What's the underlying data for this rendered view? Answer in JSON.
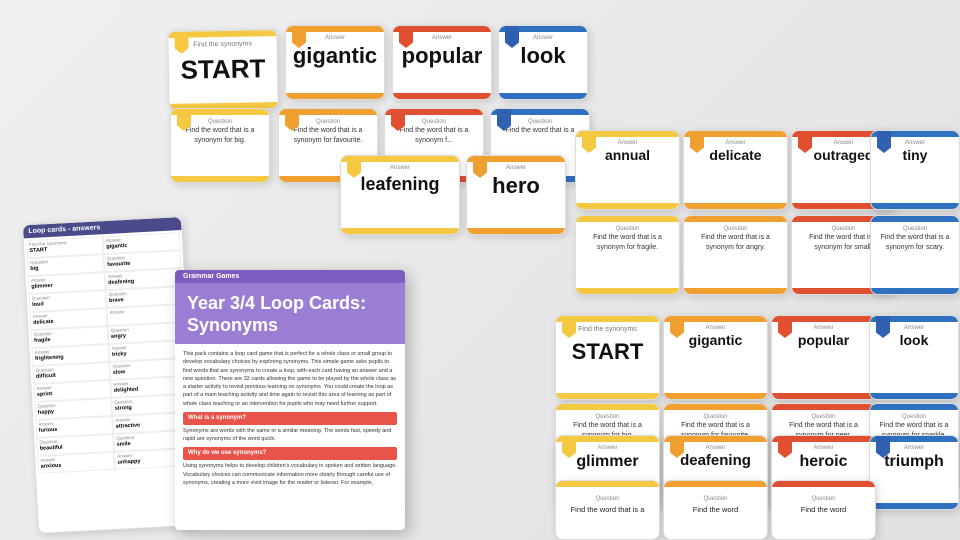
{
  "scene": {
    "bg_color": "#e8e8e8"
  },
  "answer_sheet": {
    "header": "Loop cards - answers",
    "cells": [
      {
        "label": "Find the synonyms",
        "val": "START"
      },
      {
        "label": "Answer",
        "val": "gigantic"
      },
      {
        "label": "Question",
        "val": "big"
      },
      {
        "label": "Question",
        "val": "favourite"
      },
      {
        "label": "Answer",
        "val": "glimmer"
      },
      {
        "label": "Answer",
        "val": "deafening"
      },
      {
        "label": "Question",
        "val": "loud"
      },
      {
        "label": "Question",
        "val": "brave"
      },
      {
        "label": "Answer",
        "val": "delicate"
      },
      {
        "label": "Answer",
        "val": ""
      },
      {
        "label": "Question",
        "val": "fragile"
      },
      {
        "label": "Question",
        "val": "angry"
      },
      {
        "label": "Answer",
        "val": "frightening"
      },
      {
        "label": "Answer",
        "val": "tricky"
      },
      {
        "label": "Question",
        "val": "difficult"
      },
      {
        "label": "Question",
        "val": "slow"
      },
      {
        "label": "Answer",
        "val": "sprint"
      },
      {
        "label": "Answer",
        "val": "delighted"
      },
      {
        "label": "Question",
        "val": "happy"
      },
      {
        "label": "Question",
        "val": "strong"
      },
      {
        "label": "Answer",
        "val": "furious"
      },
      {
        "label": "Answer",
        "val": "attractive"
      },
      {
        "label": "Question",
        "val": "beautiful"
      },
      {
        "label": "Question",
        "val": "smile"
      },
      {
        "label": "Answer",
        "val": "anxious"
      },
      {
        "label": "Answer",
        "val": "unhappy"
      }
    ]
  },
  "teacher_notes": {
    "top_bar": "Grammar Games",
    "title_line1": "Year 3/4 Loop Cards:",
    "title_line2": "Synonyms",
    "body_text": "This pack contains a loop card game that is perfect for a whole class or small group to develop vocabulary choices by exploring synonyms. This simple game asks pupils to find words that are synonyms to create a loop, with each card having an answer and a new question. There are 32 cards allowing the game to be played by the whole class as a starter activity to revisit previous learning on synonyms. You could create the loop as part of a main teaching activity and time again to revisit this area of learning as part of whole class teaching or an intervention for pupils who may need further support.",
    "section1_header": "What is a synonym?",
    "section1_text": "Synonyms are words with the same or a similar meaning. The words fast, speedy and rapid are synonyms of the word quick.",
    "section2_header": "Why do we use synonyms?",
    "section2_text": "Using synonyms helps to develop children's vocabulary in spoken and written language. Vocabulary choices can communicate information more clearly through careful use of synonyms, creating a more vivid image for the reader or listener. For example,"
  },
  "cards": {
    "top_row": {
      "start_label": "Find the synonyms",
      "start_word": "START",
      "gigantic": "gigantic",
      "popular": "popular",
      "look": "look"
    },
    "q_row1": {
      "q1": {
        "label": "Question",
        "text": "Find the word that is a synonym for big."
      },
      "q2": {
        "label": "Question",
        "text": "Find the word that is a synonym for favourite."
      },
      "q3": {
        "label": "Question",
        "text": "Find the word that is a synonym f..."
      },
      "q4": {
        "label": "Question",
        "text": "Find the word that is a"
      }
    },
    "mid_row": {
      "leafening": "leafening",
      "hero": "hero"
    },
    "right_cluster": {
      "annual": "annual",
      "delicate": "delicate",
      "outraged": "outraged",
      "tiny": "tiny",
      "q_fragile": "Find the word that is a synonym for fragile.",
      "q_angry": "Find the word that is a synonym for angry.",
      "q_small": "Find the word that is a synonym for small.",
      "q_scary": "Find the word that is a synonym for scary."
    },
    "bottom_set1": {
      "start_label": "Find the synonyms",
      "start_word": "START",
      "gigantic": "gigantic",
      "popular": "popular",
      "look": "look",
      "q_big": "Find the word that is a synonym for big.",
      "q_fav": "Find the word that is a synonym for favourite.",
      "q_peer": "Find the word that is a synonym for peer.",
      "q_sparkle": "Find the word that is a synonym for sparkle."
    },
    "bottom_set2": {
      "glimmer": "glimmer",
      "deafening": "deafening",
      "heroic": "heroic",
      "triumph": "triumph",
      "q_bottom1": "Find the word",
      "q_bottom2": "Find the word",
      "q_bottom3": "Find the word"
    }
  },
  "colors": {
    "yellow": "#f5c842",
    "orange": "#f0a030",
    "red": "#e05030",
    "blue": "#3070c0",
    "purple": "#7c5cbf",
    "stripe1": "#f5c842",
    "stripe2": "#e05030",
    "stripe3": "#3070c0"
  }
}
